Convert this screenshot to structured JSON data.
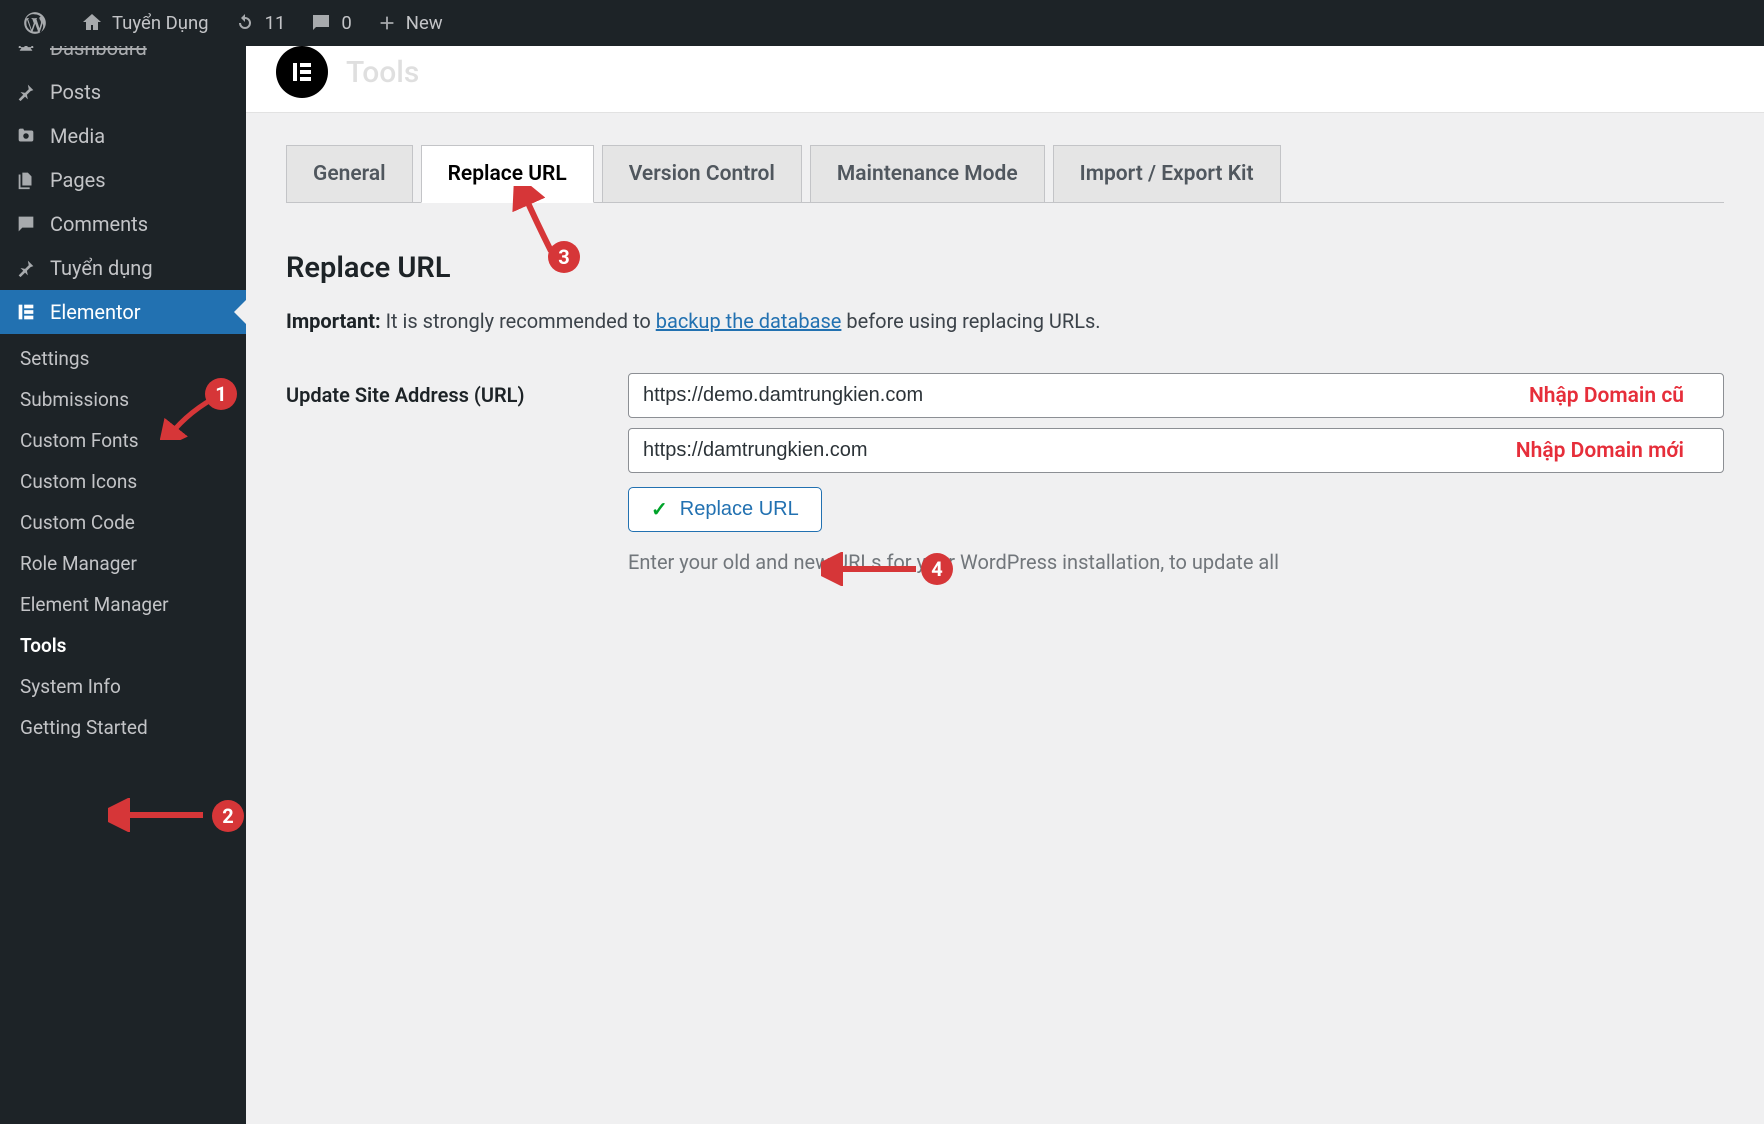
{
  "adminbar": {
    "site_name": "Tuyển Dụng",
    "updates_count": "11",
    "comments_count": "0",
    "new_label": "New"
  },
  "sidebar": {
    "dashboard": "Dashboard",
    "posts": "Posts",
    "media": "Media",
    "pages": "Pages",
    "comments": "Comments",
    "tuyen_dung": "Tuyển dụng",
    "elementor": "Elementor",
    "submenu": {
      "settings": "Settings",
      "submissions": "Submissions",
      "custom_fonts": "Custom Fonts",
      "custom_icons": "Custom Icons",
      "custom_code": "Custom Code",
      "role_manager": "Role Manager",
      "element_manager": "Element Manager",
      "tools": "Tools",
      "system_info": "System Info",
      "getting_started": "Getting Started"
    }
  },
  "page": {
    "title": "Tools"
  },
  "tabs": {
    "general": "General",
    "replace_url": "Replace URL",
    "version_control": "Version Control",
    "maintenance_mode": "Maintenance Mode",
    "import_export": "Import / Export Kit"
  },
  "section": {
    "heading": "Replace URL",
    "important_prefix": "Important:",
    "important_text_1": " It is strongly recommended to ",
    "important_link": "backup the database",
    "important_text_2": " before using replacing URLs.",
    "form_label": "Update Site Address (URL)",
    "old_url_value": "https://demo.damtrungkien.com",
    "old_url_annot": "Nhập Domain cũ",
    "new_url_value": "https://damtrungkien.com",
    "new_url_annot": "Nhập Domain mới",
    "button_label": "Replace URL",
    "help_text": "Enter your old and new URLs for your WordPress installation, to update all "
  },
  "annotations": {
    "n1": "1",
    "n2": "2",
    "n3": "3",
    "n4": "4"
  }
}
